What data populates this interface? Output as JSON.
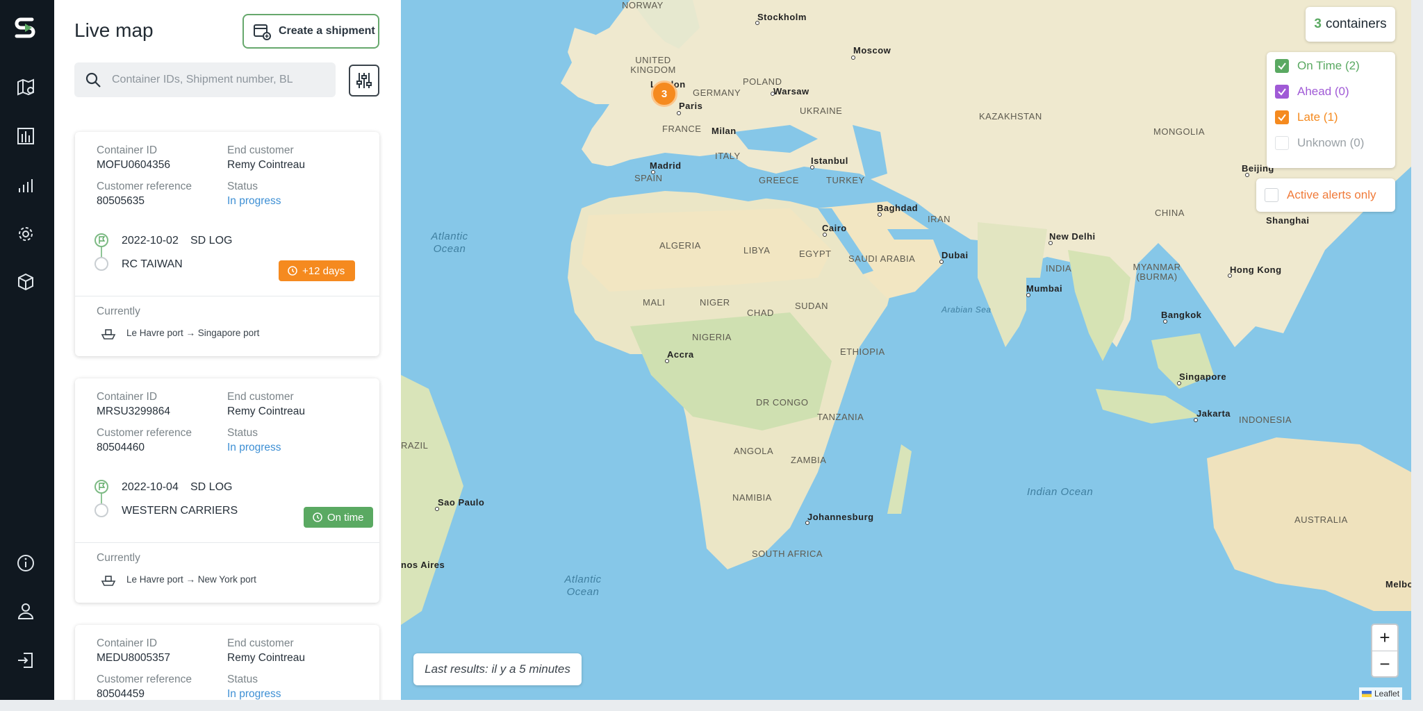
{
  "panel": {
    "title": "Live map",
    "create_label": "Create a shipment",
    "search_placeholder": "Container IDs, Shipment number, BL"
  },
  "labels": {
    "container_id": "Container ID",
    "end_customer": "End customer",
    "customer_reference": "Customer reference",
    "status": "Status",
    "currently": "Currently"
  },
  "cards": [
    {
      "container_id": "MOFU0604356",
      "end_customer": "Remy Cointreau",
      "customer_reference": "80505635",
      "status": "In progress",
      "date": "2022-10-02",
      "origin": "SD LOG",
      "carrier": "RC TAIWAN",
      "badge": "+12 days",
      "route": "Le Havre port → Singapore port"
    },
    {
      "container_id": "MRSU3299864",
      "end_customer": "Remy Cointreau",
      "customer_reference": "80504460",
      "status": "In progress",
      "date": "2022-10-04",
      "origin": "SD LOG",
      "carrier": "WESTERN CARRIERS",
      "badge": "On time",
      "route": "Le Havre port → New York port"
    },
    {
      "container_id": "MEDU8005357",
      "end_customer": "Remy Cointreau",
      "customer_reference": "80504459",
      "status": "In progress"
    }
  ],
  "map": {
    "cluster_count": "3",
    "containers_count": "3",
    "containers_label": "containers",
    "legend": [
      {
        "label": "On Time (2)",
        "color": "#5aa962",
        "checked": true
      },
      {
        "label": "Ahead (0)",
        "color": "#a05ad6",
        "checked": true
      },
      {
        "label": "Late (1)",
        "color": "#f58a1f",
        "checked": true
      },
      {
        "label": "Unknown (0)",
        "color": "#9aa1a6",
        "checked": false
      }
    ],
    "active_alerts_label": "Active alerts only",
    "last_results": "Last results: il y a 5 minutes",
    "zoom_in": "+",
    "zoom_out": "−",
    "attribution": "Leaflet",
    "countries": {
      "norway": "NORWAY",
      "uk": "UNITED KINGDOM",
      "germany": "GERMANY",
      "poland": "POLAND",
      "ukraine": "UKRAINE",
      "france": "FRANCE",
      "italy": "ITALY",
      "spain": "SPAIN",
      "greece": "GREECE",
      "turkey": "TURKEY",
      "kazakhstan": "KAZAKHSTAN",
      "mongolia": "MONGOLIA",
      "china": "CHINA",
      "iran": "IRAN",
      "india": "INDIA",
      "myanmar": "MYANMAR (BURMA)",
      "algeria": "ALGERIA",
      "libya": "LIBYA",
      "egypt": "EGYPT",
      "saudi": "SAUDI ARABIA",
      "mali": "MALI",
      "niger": "NIGER",
      "chad": "CHAD",
      "sudan": "SUDAN",
      "nigeria": "NIGERIA",
      "ethiopia": "ETHIOPIA",
      "drcongo": "DR CONGO",
      "tanzania": "TANZANIA",
      "angola": "ANGOLA",
      "zambia": "ZAMBIA",
      "namibia": "NAMIBIA",
      "southafrica": "SOUTH AFRICA",
      "brazil": "RAZIL",
      "indonesia": "INDONESIA",
      "australia": "AUSTRALIA"
    },
    "cities": {
      "stockholm": "Stockholm",
      "moscow": "Moscow",
      "london": "London",
      "warsaw": "Warsaw",
      "paris": "Paris",
      "milan": "Milan",
      "madrid": "Madrid",
      "istanbul": "Istanbul",
      "baghdad": "Baghdad",
      "cairo": "Cairo",
      "dubai": "Dubai",
      "newdelhi": "New Delhi",
      "mumbai": "Mumbai",
      "beijing": "Beijing",
      "shanghai": "Shanghai",
      "hongkong": "Hong Kong",
      "bangkok": "Bangkok",
      "singapore": "Singapore",
      "jakarta": "Jakarta",
      "accra": "Accra",
      "johannesburg": "Johannesburg",
      "saopaulo": "Sao Paulo",
      "buenosaires": "nos Aires",
      "melbourne": "Melbo"
    },
    "oceans": {
      "atlantic_n": "Atlantic Ocean",
      "atlantic_s": "Atlantic Ocean",
      "indian": "Indian Ocean",
      "arabian": "Arabian Sea"
    }
  }
}
